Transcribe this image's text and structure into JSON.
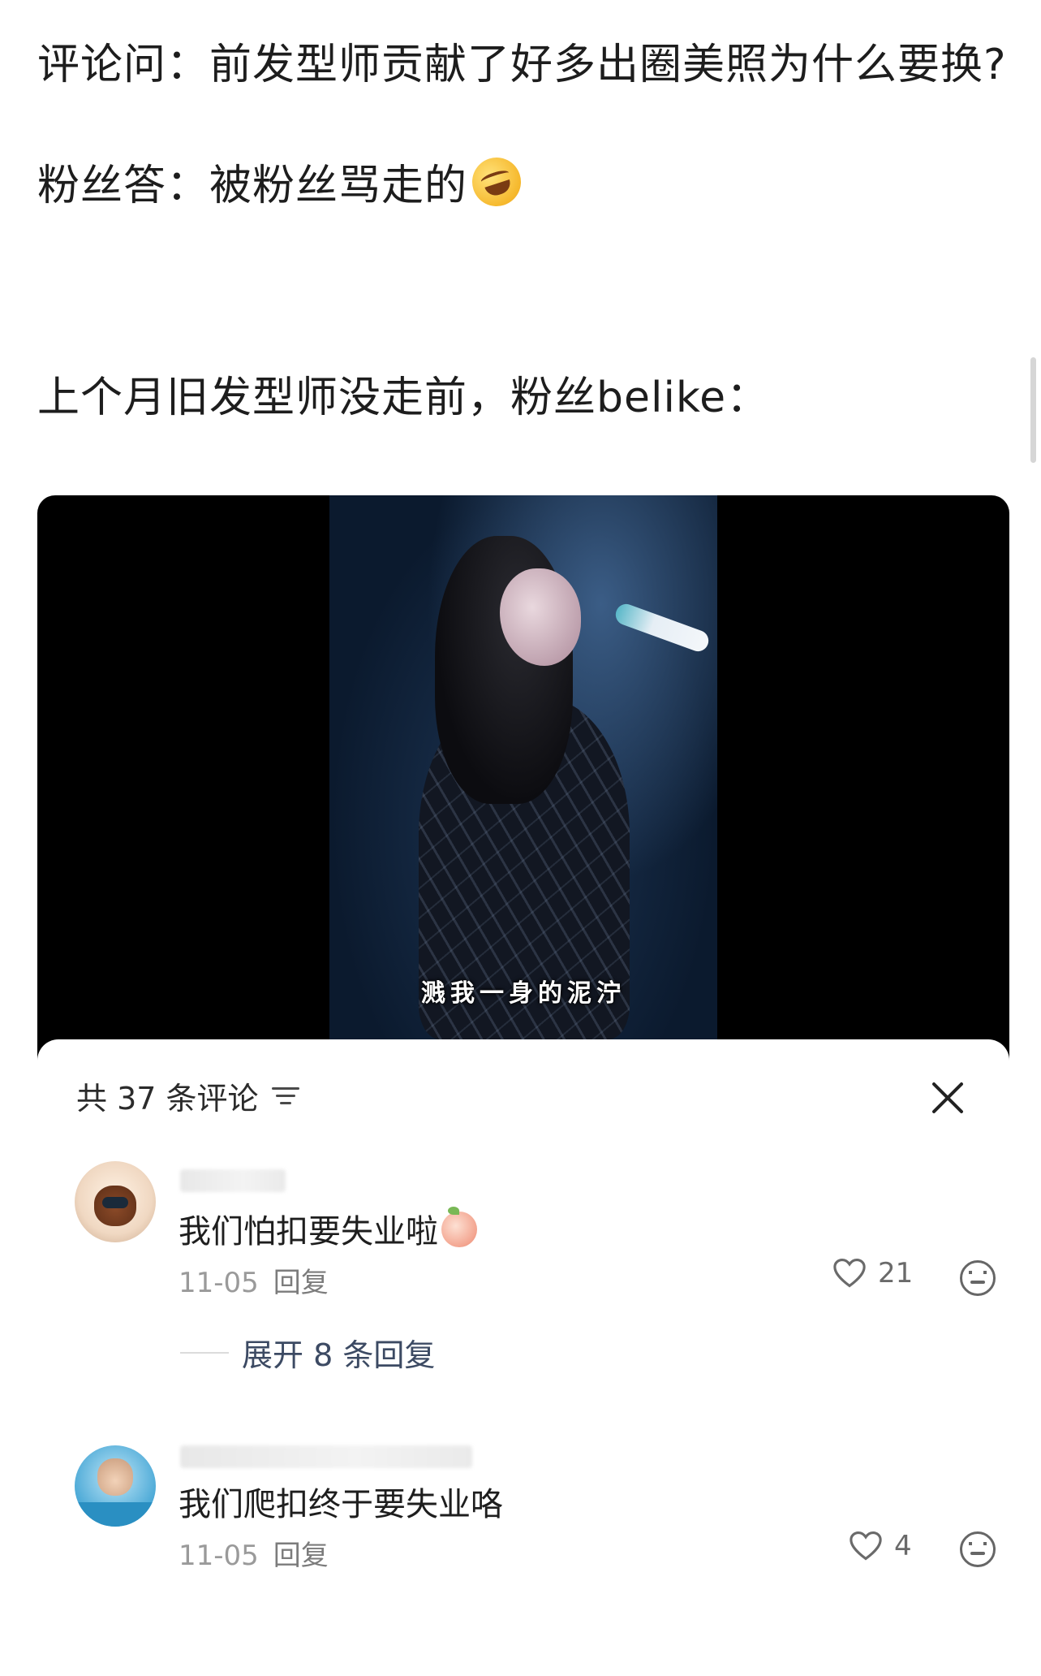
{
  "post": {
    "line1": "评论问：前发型师贡献了好多出圈美照为什么要换?",
    "line2": "粉丝答：被粉丝骂走的",
    "line3": "上个月旧发型师没走前，粉丝belike："
  },
  "video": {
    "subtitle": "溅我一身的泥泞"
  },
  "comments_sheet": {
    "title": "共 37 条评论",
    "comments": [
      {
        "text": "我们怕扣要失业啦",
        "date": "11-05",
        "reply_label": "回复",
        "likes": "21",
        "expand_label": "展开 8 条回复"
      },
      {
        "text": "我们爬扣终于要失业咯",
        "date": "11-05",
        "reply_label": "回复",
        "likes": "4"
      }
    ]
  },
  "colors": {
    "accent_link": "#3c4a63",
    "meta_text": "#9a9a9a",
    "background": "#ffffff"
  },
  "icons": [
    "laughing-emoji",
    "filter-icon",
    "close-icon",
    "peach-emoji",
    "heart-icon",
    "sticker-face-icon"
  ]
}
